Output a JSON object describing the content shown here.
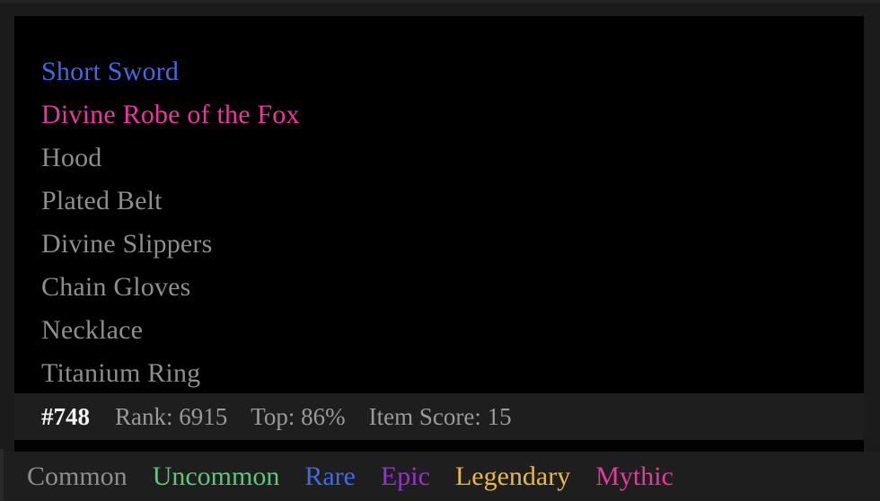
{
  "bag": {
    "items": [
      {
        "name": "Short Sword",
        "rarity": "rare"
      },
      {
        "name": "Divine Robe of the Fox",
        "rarity": "mythic"
      },
      {
        "name": "Hood",
        "rarity": "common"
      },
      {
        "name": "Plated Belt",
        "rarity": "common"
      },
      {
        "name": "Divine Slippers",
        "rarity": "common"
      },
      {
        "name": "Chain Gloves",
        "rarity": "common"
      },
      {
        "name": "Necklace",
        "rarity": "common"
      },
      {
        "name": "Titanium Ring",
        "rarity": "common"
      }
    ]
  },
  "status": {
    "bag_id": "#748",
    "rank": "Rank: 6915",
    "top_percent": "Top: 86%",
    "item_score": "Item Score: 15"
  },
  "legend": {
    "items": [
      {
        "label": "Common",
        "color": "#8e8e8e"
      },
      {
        "label": "Uncommon",
        "color": "#5ec77f"
      },
      {
        "label": "Rare",
        "color": "#4169e1"
      },
      {
        "label": "Epic",
        "color": "#9b30d0"
      },
      {
        "label": "Legendary",
        "color": "#e8b84b"
      },
      {
        "label": "Mythic",
        "color": "#e6399b"
      }
    ]
  },
  "colors": {
    "background": "#1b1b1b",
    "panel": "#000000",
    "bar": "#1e1e1e",
    "bag_id_text": "#f2f2f2",
    "stat_text": "#9a9a9a"
  }
}
